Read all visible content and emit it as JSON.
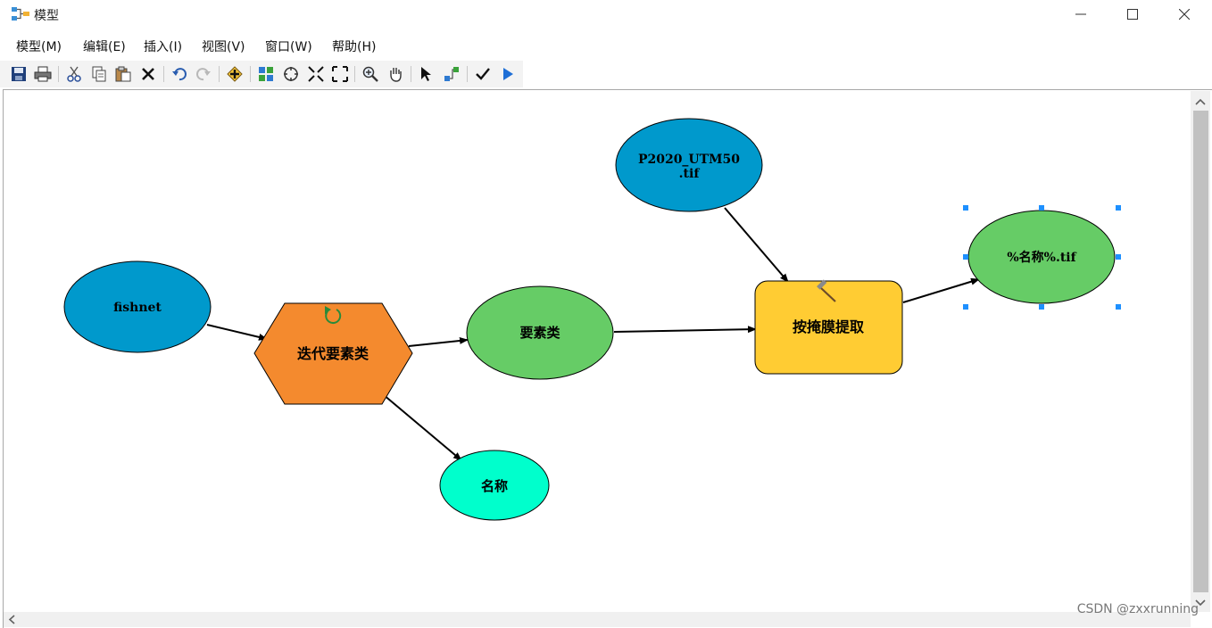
{
  "window": {
    "title": "模型"
  },
  "menu": [
    {
      "label": "模型(M)"
    },
    {
      "label": "编辑(E)"
    },
    {
      "label": "插入(I)"
    },
    {
      "label": "视图(V)"
    },
    {
      "label": "窗口(W)"
    },
    {
      "label": "帮助(H)"
    }
  ],
  "toolbar": {
    "buttons": [
      "save-icon",
      "print-icon",
      "cut-icon",
      "copy-icon",
      "paste-icon",
      "delete-icon",
      "undo-icon",
      "redo-icon",
      "add-data-icon",
      "auto-layout-icon",
      "full-extent-icon",
      "fixed-zoom-in-icon",
      "fixed-zoom-out-icon",
      "zoom-in-icon",
      "pan-icon",
      "select-icon",
      "connect-icon",
      "validate-icon",
      "run-icon"
    ]
  },
  "model": {
    "nodes": {
      "fishnet": {
        "label": "fishnet",
        "color": "#0099cc"
      },
      "iterate": {
        "label": "迭代要素类",
        "color": "#f48a2e"
      },
      "feature_class": {
        "label": "要素类",
        "color": "#66cc66"
      },
      "name": {
        "label": "名称",
        "color": "#00ffcc"
      },
      "raster": {
        "label_line1": "P2020_UTM50",
        "label_line2": ".tif",
        "color": "#0099cc"
      },
      "extract": {
        "label": "按掩膜提取",
        "color": "#ffcc33"
      },
      "output": {
        "label": "%名称%.tif",
        "color": "#66cc66"
      }
    }
  },
  "watermark": "CSDN @zxxrunning"
}
